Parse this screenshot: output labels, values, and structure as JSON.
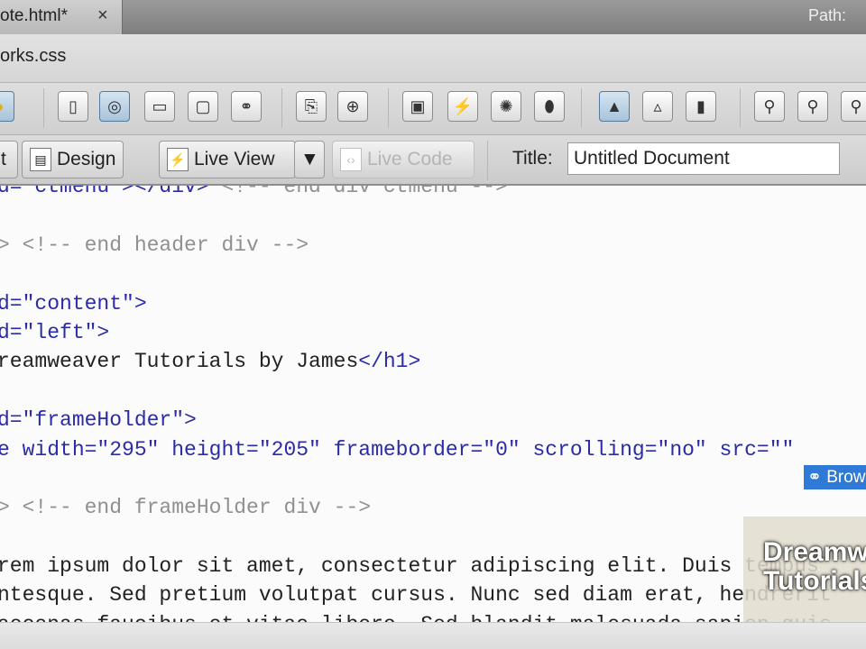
{
  "tabbar": {
    "tab_label": "ote.html*",
    "close": "×",
    "path_label": "Path:"
  },
  "related": {
    "file": "orks.css"
  },
  "toolbar_icons": [
    "●",
    "▯",
    "◎",
    "▭",
    "▢",
    "⚭",
    "⎘",
    "⊕",
    "▣",
    "⚡",
    "✺",
    "⬮",
    "▲",
    "▵",
    "▮",
    "⚲",
    "⚲",
    "⚲"
  ],
  "doc_toolbar": {
    "code_label": "t",
    "design_label": "Design",
    "live_view_label": "Live View",
    "live_view_menu": "▼",
    "live_code_label": "Live Code",
    "title_label": "Title:",
    "title_value": "Untitled Document"
  },
  "code_lines": [
    [
      {
        "t": "d=\"ctmenu\"></div>",
        "k": "tag"
      },
      {
        "t": " <!-- end div ctmenu -->",
        "k": "cmt"
      }
    ],
    [],
    [
      {
        "t": "> <!-- end header div -->",
        "k": "cmt"
      }
    ],
    [],
    [
      {
        "t": "d=\"content\">",
        "k": "tag"
      }
    ],
    [
      {
        "t": "d=\"left\">",
        "k": "tag"
      }
    ],
    [
      {
        "t": "reamweaver Tutorials by James",
        "k": "txt"
      },
      {
        "t": "</h1>",
        "k": "tag"
      }
    ],
    [],
    [
      {
        "t": "d=\"frameHolder\">",
        "k": "tag"
      }
    ],
    [
      {
        "t": "e width=\"295\" height=\"205\" frameborder=\"0\" scrolling=\"no\" src=\"\"",
        "k": "tag"
      }
    ],
    [],
    [
      {
        "t": "> <!-- end frameHolder div -->",
        "k": "cmt"
      }
    ],
    [],
    [
      {
        "t": "rem ipsum dolor sit amet, consectetur adipiscing elit. Duis tempus",
        "k": "txt"
      }
    ],
    [
      {
        "t": "ntesque. Sed pretium volutpat cursus. Nunc sed diam erat, hendrerit",
        "k": "txt"
      }
    ],
    [
      {
        "t": "aecenas faucibus et vitae libero. Sed blandit malesuada sapien quis",
        "k": "txt"
      }
    ]
  ],
  "code_hint": {
    "icon": "⚭",
    "label": "Browse..."
  },
  "watermark": {
    "line1": "Dreamweaver",
    "line2": "Tutorials"
  }
}
